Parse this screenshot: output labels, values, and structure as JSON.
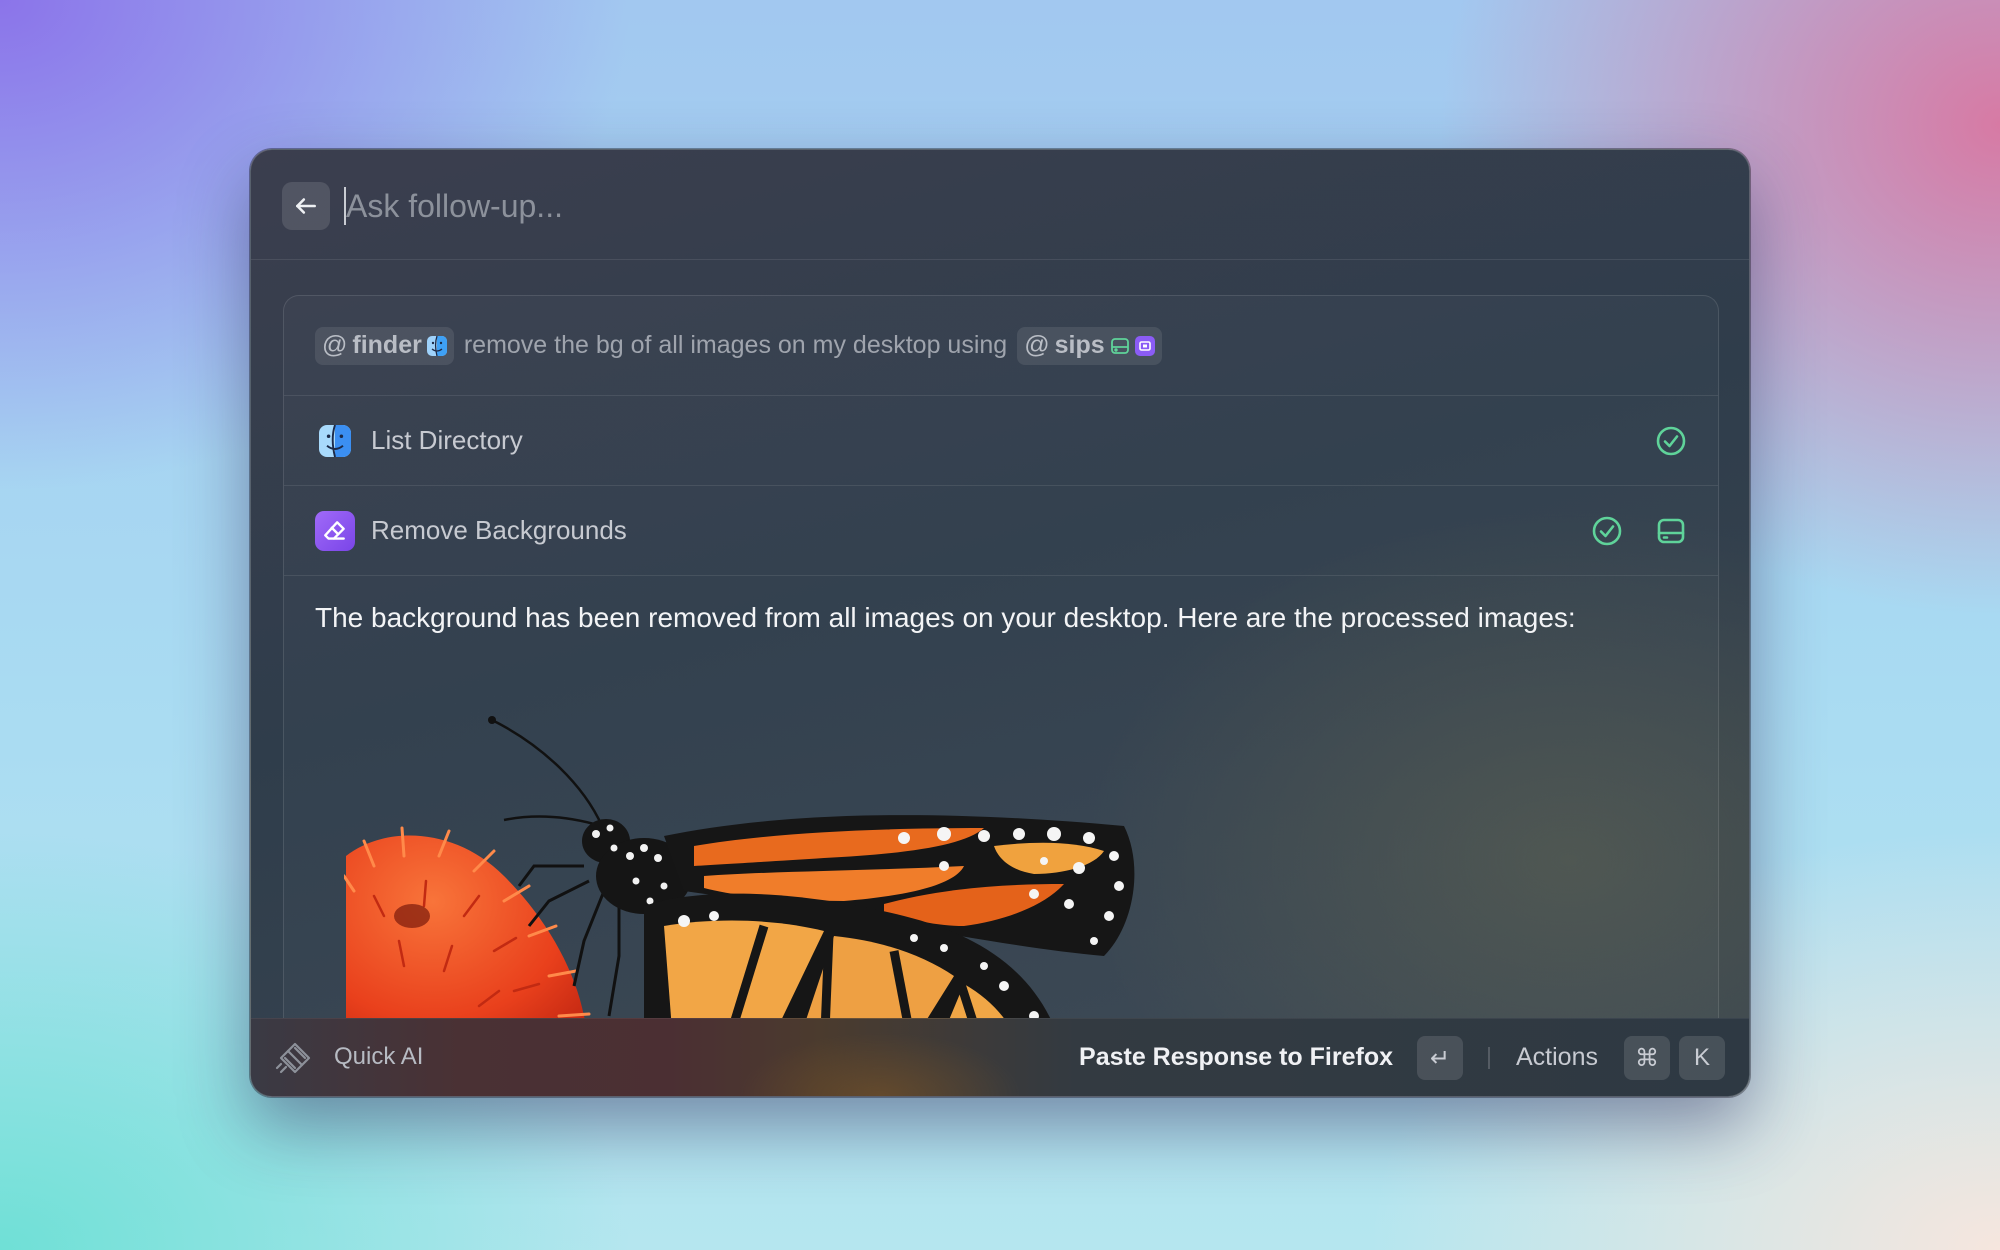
{
  "input": {
    "placeholder": "Ask follow-up..."
  },
  "prompt": {
    "mentions": [
      {
        "at": "@",
        "name": "finder",
        "icon": "finder-icon"
      },
      {
        "at": "@",
        "name": "sips",
        "icon": "sips-icons"
      }
    ],
    "text": "remove the bg of all images on my desktop using"
  },
  "tools": [
    {
      "label": "List Directory",
      "icon": "finder-icon",
      "status": "check-circle-icon"
    },
    {
      "label": "Remove Backgrounds",
      "icon": "eraser-icon",
      "status": "check-circle-icon",
      "extra": "drive-icon"
    }
  ],
  "response": {
    "text": "The background has been removed from all images on your desktop. Here are the processed images:",
    "image": "butterfly-on-flower-image"
  },
  "footer": {
    "app_name": "Quick AI",
    "primary_action": "Paste Response to Firefox",
    "enter_key": "↵",
    "actions_label": "Actions",
    "cmd_key": "⌘",
    "k_key": "K"
  },
  "colors": {
    "success": "#5fd39a",
    "accent_purple": "#8b5cf6",
    "finder_blue": "#3ea0f5"
  }
}
